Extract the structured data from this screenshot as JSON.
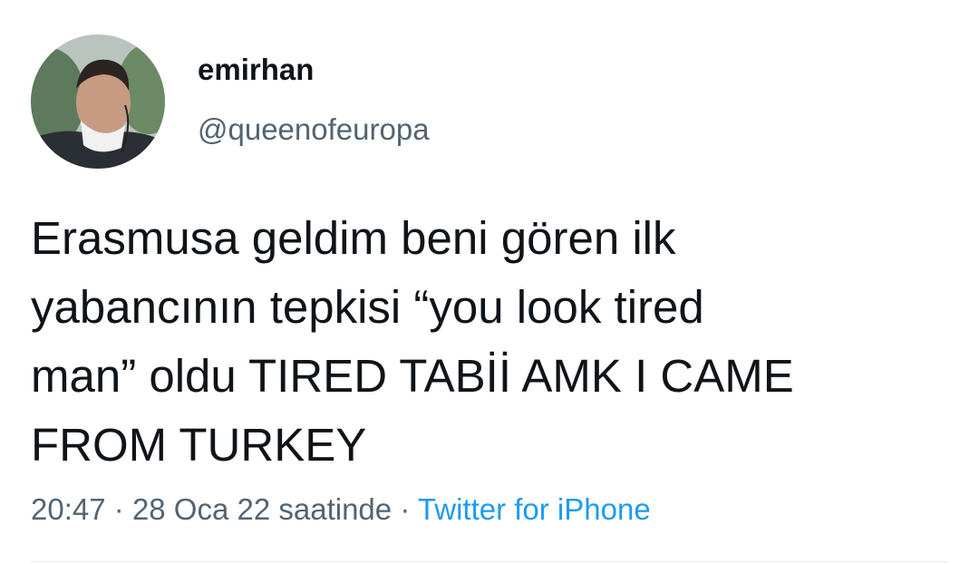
{
  "user": {
    "display_name": "emirhan",
    "handle": "@queenofeuropa"
  },
  "tweet": {
    "lines": [
      "Erasmusa geldim beni gören ilk",
      "yabancının tepkisi “you look tired",
      "man” oldu TIRED TABİİ AMK I CAME",
      "FROM TURKEY"
    ]
  },
  "meta": {
    "time": "20:47",
    "date": "28 Oca 22 saatinde",
    "separator": "·",
    "source": "Twitter for iPhone"
  },
  "colors": {
    "text": "#0f1419",
    "secondary": "#536471",
    "link": "#1d9bf0"
  }
}
